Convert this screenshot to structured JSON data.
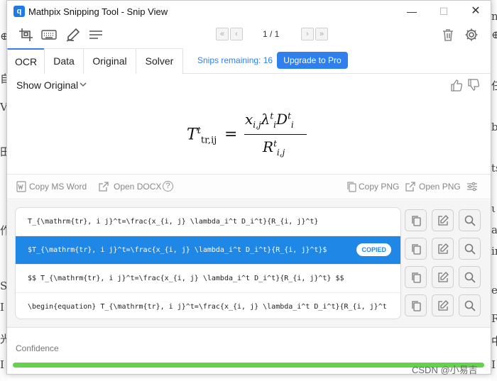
{
  "window": {
    "title": "Mathpix Snipping Tool - Snip View",
    "logo_text": "q",
    "min": "—",
    "max": "☐",
    "close": "✕"
  },
  "toolbar": {
    "icons": [
      "screenshot-icon",
      "keyboard-icon",
      "pen-icon",
      "menu-icon"
    ],
    "pager": {
      "first": "«",
      "prev": "‹",
      "page": "1 / 1",
      "next": "›",
      "last": "»"
    }
  },
  "tabs": [
    {
      "label": "OCR",
      "active": true
    },
    {
      "label": "Data",
      "active": false
    },
    {
      "label": "Original",
      "active": false
    },
    {
      "label": "Solver",
      "active": false
    }
  ],
  "snips_remaining": "Snips remaining: 16",
  "upgrade_label": "Upgrade to Pro",
  "show_original": "Show Original",
  "formula": {
    "lhs_base": "T",
    "lhs_sup": "t",
    "lhs_sub": "tr,ij",
    "eq": "=",
    "num_x": "x",
    "num_x_sub": "i,j",
    "num_lambda": "λ",
    "num_lambda_sup": "t",
    "num_lambda_sub": "i",
    "num_d": "D",
    "num_d_sup": "t",
    "num_d_sub": "i",
    "den_r": "R",
    "den_r_sup": "t",
    "den_r_sub": "i,j"
  },
  "actions": {
    "copy_ms_word": "Copy MS Word",
    "open_docx": "Open DOCX",
    "help": "?",
    "copy_png": "Copy PNG",
    "open_png": "Open PNG"
  },
  "results": [
    {
      "text": "T_{\\mathrm{tr}, i j}^t=\\frac{x_{i, j} \\lambda_i^t D_i^t}{R_{i, j}^t}",
      "selected": false
    },
    {
      "text": "$T_{\\mathrm{tr}, i j}^t=\\frac{x_{i, j} \\lambda_i^t D_i^t}{R_{i, j}^t}$",
      "selected": true,
      "badge": "COPIED"
    },
    {
      "text": "$$  T_{\\mathrm{tr}, i j}^t=\\frac{x_{i, j} \\lambda_i^t D_i^t}{R_{i, j}^t}  $$",
      "selected": false
    },
    {
      "text": "\\begin{equation}  T_{\\mathrm{tr}, i j}^t=\\frac{x_{i, j} \\lambda_i^t D_i^t}{R_{i, j}^t",
      "selected": false
    }
  ],
  "confidence": {
    "label": "Confidence",
    "value": 1.0,
    "color": "#62d44c"
  },
  "accent": "#2f80ed",
  "selected_row_color": "#1f87e5",
  "watermark": "CSDN @小易吉",
  "background_doc": {
    "left_glyphs": [
      "⊕",
      "自",
      "V",
      "田",
      "作",
      "S",
      "I",
      "光",
      "I"
    ],
    "right_glyphs": [
      "ne",
      "⊕",
      "任",
      "b",
      "ts",
      "ι",
      "a",
      "ir",
      "ec",
      "Ra",
      "中",
      "I"
    ]
  }
}
